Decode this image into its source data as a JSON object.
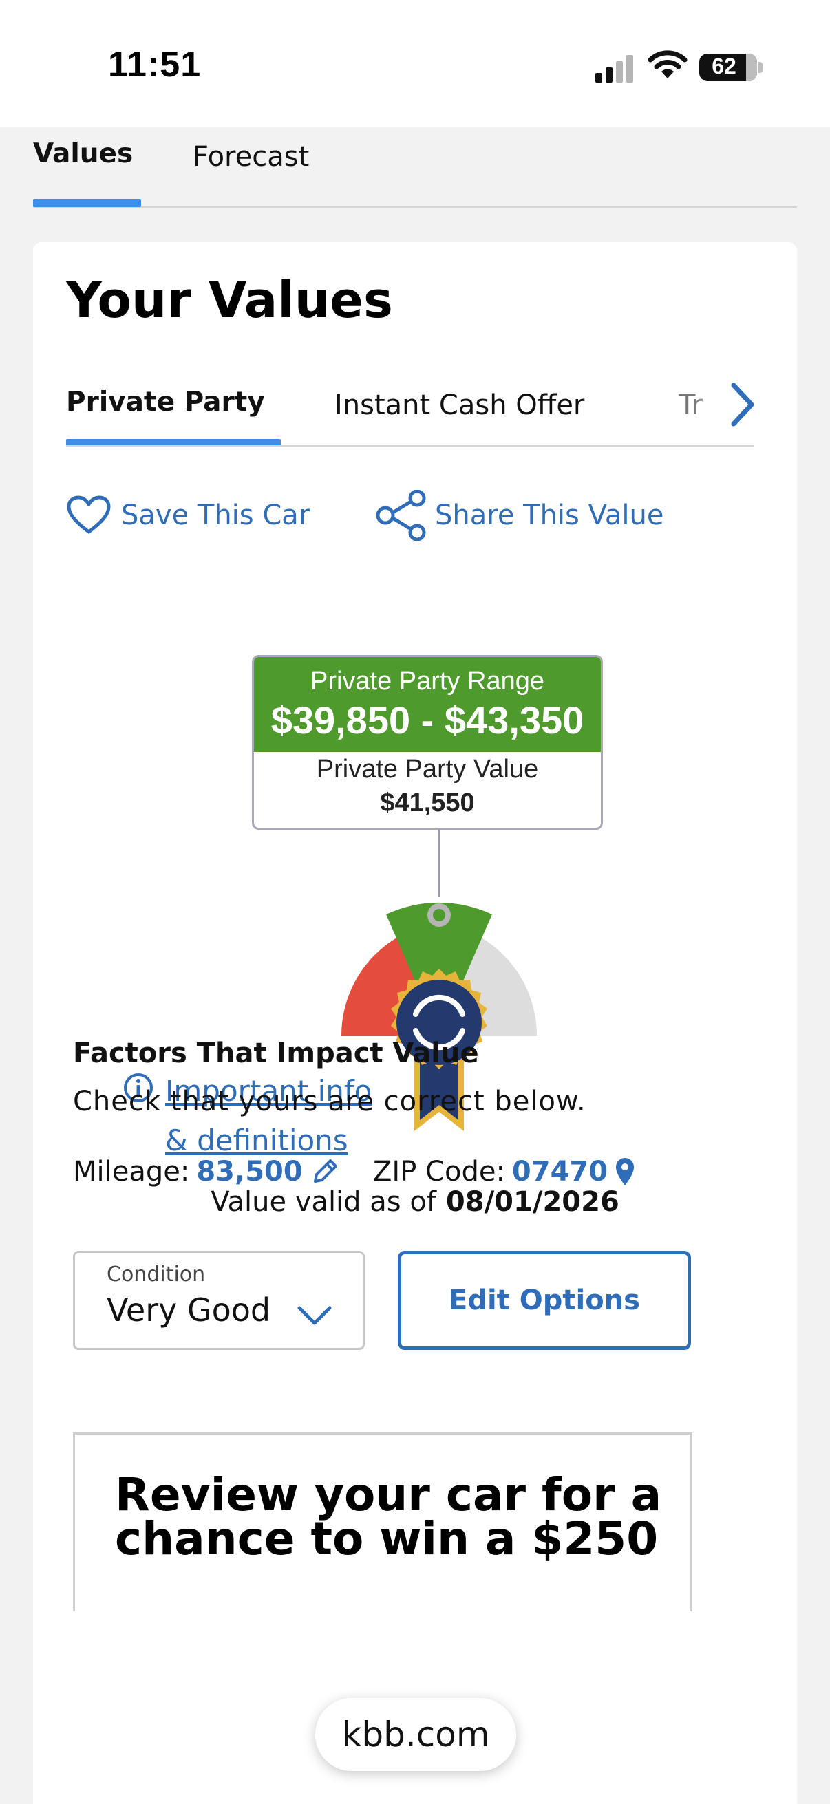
{
  "status_bar": {
    "time": "11:51",
    "battery": "62"
  },
  "top_tabs": {
    "items": [
      {
        "label": "Values",
        "active": true
      },
      {
        "label": "Forecast",
        "active": false
      }
    ],
    "accent": "#3d8ee8"
  },
  "card": {
    "title": "Your Values",
    "value_tabs": [
      {
        "label": "Private Party",
        "active": true
      },
      {
        "label": "Instant Cash Offer",
        "active": false
      },
      {
        "label": "Tr",
        "active": false
      }
    ]
  },
  "actions": {
    "save_label": "Save This Car",
    "share_label": "Share This Value",
    "save_icon": "heart-icon",
    "share_icon": "share-icon"
  },
  "valuation": {
    "range_title": "Private Party Range",
    "range_value": "$39,850 - $43,350",
    "value_label": "Private Party Value",
    "value": "$41,550",
    "colors": {
      "range_green": "#4f9a2c",
      "gauge_red": "#e44d3e",
      "gauge_gray": "#dddddd",
      "badge_navy": "#243a6e",
      "badge_gold": "#e6b43a"
    }
  },
  "info": {
    "link_line1": "Important info",
    "link_line2": "& definitions"
  },
  "validity": {
    "prefix": "Value valid as of",
    "date": "08/01/2026"
  },
  "factors": {
    "title": "Factors That Impact Value",
    "subtitle": "Check that yours are correct below.",
    "mileage_label": "Mileage:",
    "mileage_value": "83,500",
    "zip_label": "ZIP Code:",
    "zip_value": "07470"
  },
  "condition": {
    "label": "Condition",
    "value": "Very Good"
  },
  "edit_options_label": "Edit Options",
  "promo": {
    "text": "Review your car for a chance to win a $250"
  },
  "browser": {
    "url": "kbb.com"
  }
}
